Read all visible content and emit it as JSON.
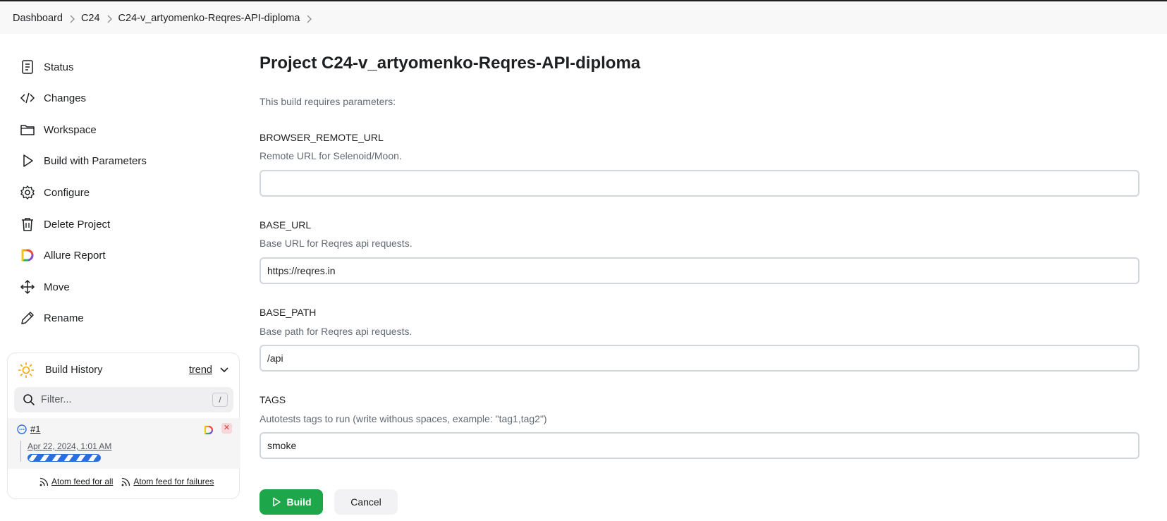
{
  "breadcrumbs": [
    "Dashboard",
    "C24",
    "C24-v_artyomenko-Reqres-API-diploma"
  ],
  "sidebar": {
    "items": [
      {
        "label": "Status",
        "icon": "status-icon"
      },
      {
        "label": "Changes",
        "icon": "code-icon"
      },
      {
        "label": "Workspace",
        "icon": "folder-icon"
      },
      {
        "label": "Build with Parameters",
        "icon": "play-icon"
      },
      {
        "label": "Configure",
        "icon": "gear-icon"
      },
      {
        "label": "Delete Project",
        "icon": "trash-icon"
      },
      {
        "label": "Allure Report",
        "icon": "allure-icon"
      },
      {
        "label": "Move",
        "icon": "move-icon"
      },
      {
        "label": "Rename",
        "icon": "pencil-icon"
      }
    ]
  },
  "build_history": {
    "title": "Build History",
    "trend_label": "trend",
    "filter_placeholder": "Filter...",
    "shortcut": "/",
    "builds": [
      {
        "number": "#1",
        "date": "Apr 22, 2024, 1:01 AM",
        "status": "in-progress"
      }
    ],
    "feed_all": "Atom feed for all",
    "feed_failures": "Atom feed for failures"
  },
  "main": {
    "title": "Project C24-v_artyomenko-Reqres-API-diploma",
    "requires_text": "This build requires parameters:",
    "params": [
      {
        "name": "BROWSER_REMOTE_URL",
        "description": "Remote URL for Selenoid/Moon.",
        "value": ""
      },
      {
        "name": "BASE_URL",
        "description": "Base URL for Reqres api requests.",
        "value": "https://reqres.in"
      },
      {
        "name": "BASE_PATH",
        "description": "Base path for Reqres api requests.",
        "value": "/api"
      },
      {
        "name": "TAGS",
        "description": "Autotests tags to run (write withous spaces, example: \"tag1,tag2\")",
        "value": "smoke"
      }
    ],
    "build_button": "Build",
    "cancel_button": "Cancel"
  },
  "colors": {
    "build_green": "#1ea64b",
    "progress_blue": "#2b6fdc",
    "abort_red": "#d23b3b"
  }
}
